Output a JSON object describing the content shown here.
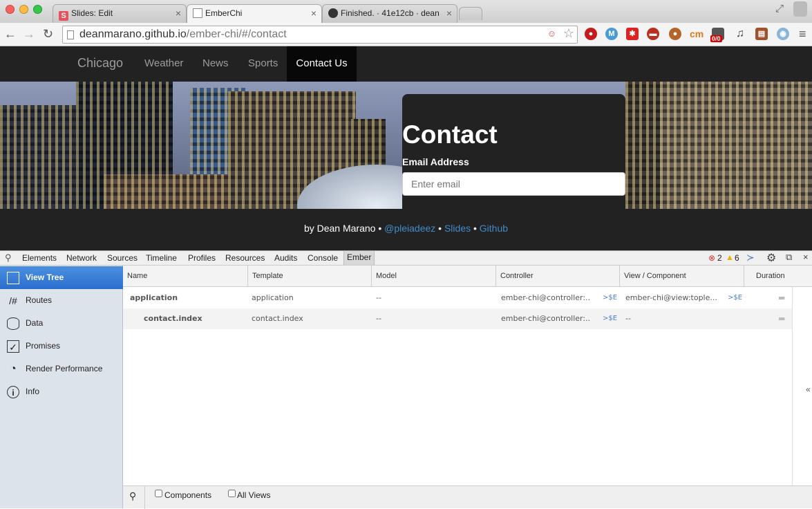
{
  "browser": {
    "tabs": [
      {
        "title": "Slides: Edit",
        "favicon": "S"
      },
      {
        "title": "EmberChi"
      },
      {
        "title": "Finished. · 41e12cb · dean"
      }
    ],
    "url": {
      "domain": "deanmarano.github.io",
      "path": "/ember-chi/#/contact"
    },
    "extension_badge": "0/0"
  },
  "site": {
    "nav": {
      "brand": "Chicago",
      "items": [
        "Weather",
        "News",
        "Sports",
        "Contact Us"
      ]
    },
    "contact": {
      "heading": "Contact",
      "email_label": "Email Address",
      "email_placeholder": "Enter email"
    },
    "footer": {
      "prefix": "by Dean Marano •",
      "links": [
        "@pleiadeez",
        "Slides",
        "Github"
      ],
      "sep": "•"
    }
  },
  "devtools": {
    "tabs": [
      "Elements",
      "Network",
      "Sources",
      "Timeline",
      "Profiles",
      "Resources",
      "Audits",
      "Console",
      "Ember"
    ],
    "errors": "2",
    "warnings": "6",
    "sidebar": [
      {
        "label": "View Tree",
        "icon": "tree-icon"
      },
      {
        "label": "Routes",
        "icon": "routes-icon",
        "glyph": "/#"
      },
      {
        "label": "Data",
        "icon": "database-icon"
      },
      {
        "label": "Promises",
        "icon": "checkbox-icon"
      },
      {
        "label": "Render Performance",
        "icon": "gauge-icon"
      },
      {
        "label": "Info",
        "icon": "info-icon"
      }
    ],
    "columns": [
      "Name",
      "Template",
      "Model",
      "Controller",
      "View / Component",
      "Duration"
    ],
    "rows": [
      {
        "name": "application",
        "template": "application",
        "model": "--",
        "controller": "ember-chi@controller:...",
        "controller_link": ">$E",
        "view": "ember-chi@view:tople...",
        "view_link": ">$E"
      },
      {
        "name": "contact.index",
        "template": "contact.index",
        "model": "--",
        "controller": "ember-chi@controller:...",
        "controller_link": ">$E",
        "view": "--",
        "view_link": ""
      }
    ],
    "bottom": {
      "components_label": "Components",
      "all_views_label": "All Views"
    }
  }
}
